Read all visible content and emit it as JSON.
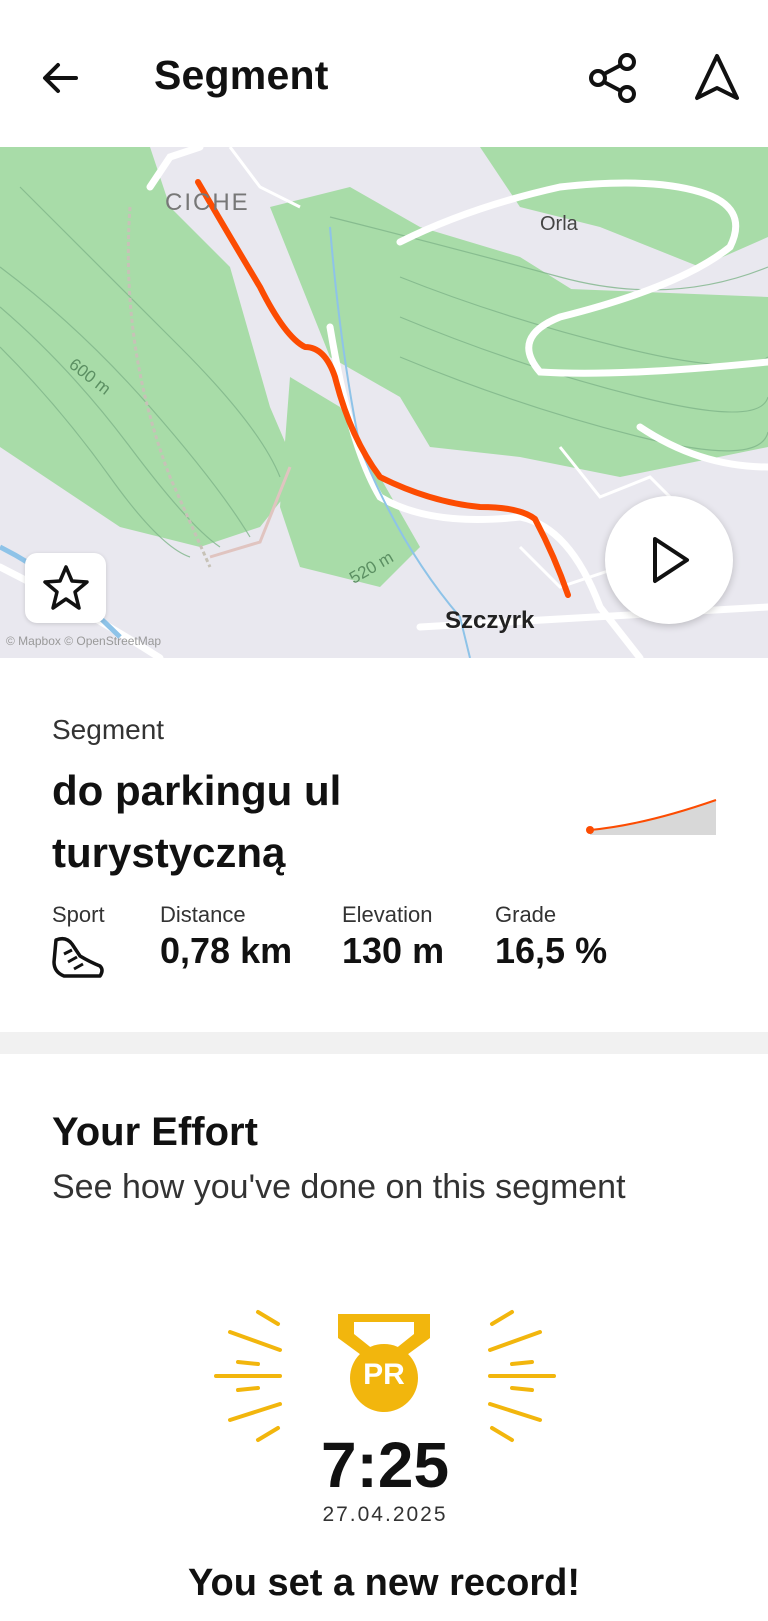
{
  "header": {
    "title": "Segment",
    "back_icon": "arrow-left-icon",
    "share_icon": "share-icon",
    "navigate_icon": "navigation-arrow-icon"
  },
  "map": {
    "labels": {
      "ciche": "CICHE",
      "orla": "Orla",
      "contour_600": "600 m",
      "contour_520": "520 m",
      "town": "Szczyrk"
    },
    "attribution": "© Mapbox © OpenStreetMap",
    "route_color": "#fc4c02",
    "favorite_icon": "star-icon",
    "play_icon": "play-icon"
  },
  "segment": {
    "label": "Segment",
    "name": "do parkingu ul turystyczną",
    "stats": [
      {
        "label": "Sport",
        "icon": "running-shoe-icon"
      },
      {
        "label": "Distance",
        "value": "0,78 km"
      },
      {
        "label": "Elevation",
        "value": "130 m"
      },
      {
        "label": "Grade",
        "value": "16,5 %"
      }
    ]
  },
  "effort": {
    "title": "Your Effort",
    "subtitle": "See how you've done on this segment",
    "badge_text": "PR",
    "badge_color": "#f2b60d",
    "time": "7:25",
    "date": "27.04.2025",
    "record_text": "You set a new record!"
  }
}
